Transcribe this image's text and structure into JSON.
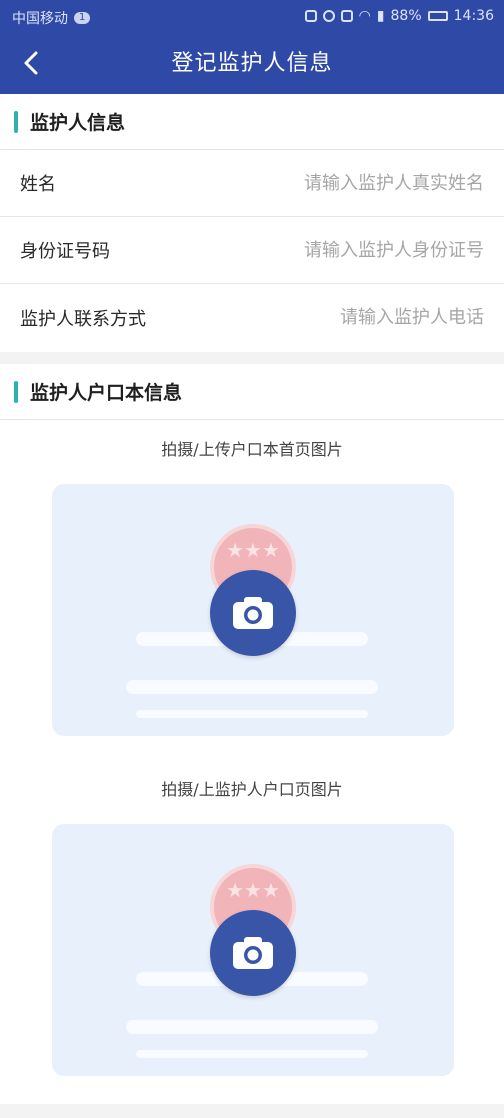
{
  "status": {
    "carrier": "中国移动",
    "sim_badge": "1",
    "battery": "88%",
    "time": "14:36"
  },
  "nav": {
    "title": "登记监护人信息"
  },
  "guardian_info": {
    "section_title": "监护人信息",
    "fields": [
      {
        "label": "姓名",
        "placeholder": "请输入监护人真实姓名",
        "value": ""
      },
      {
        "label": "身份证号码",
        "placeholder": "请输入监护人身份证号",
        "value": ""
      },
      {
        "label": "监护人联系方式",
        "placeholder": "请输入监护人电话",
        "value": ""
      }
    ]
  },
  "household": {
    "section_title": "监护人户口本信息",
    "uploads": [
      {
        "title": "拍摄/上传户口本首页图片",
        "icon": "camera-icon"
      },
      {
        "title": "拍摄/上监护人户口页图片",
        "icon": "camera-icon"
      }
    ]
  },
  "colors": {
    "primary": "#2f4aa6",
    "accent": "#2bb3b2",
    "upload_bg": "#e8f0fb"
  }
}
